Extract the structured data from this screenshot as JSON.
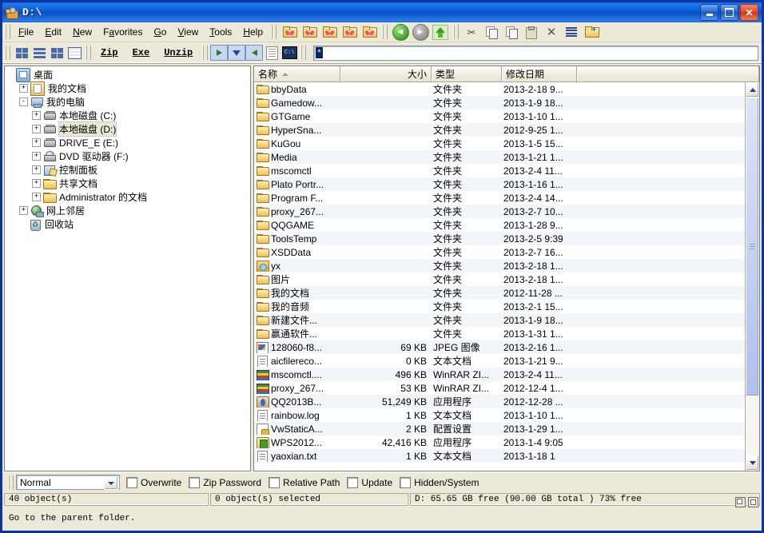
{
  "window": {
    "title": "D:\\",
    "icon": "folder-disk-icon",
    "buttons": {
      "minimize": "_",
      "maximize": "□",
      "close": "✕"
    }
  },
  "menubar": {
    "items": [
      {
        "label": "File",
        "accel": "F"
      },
      {
        "label": "Edit",
        "accel": "E"
      },
      {
        "label": "New",
        "accel": "N"
      },
      {
        "label": "Favorites",
        "accel": "a"
      },
      {
        "label": "Go",
        "accel": "G"
      },
      {
        "label": "View",
        "accel": "V"
      },
      {
        "label": "Tools",
        "accel": "T"
      },
      {
        "label": "Help",
        "accel": "H"
      }
    ],
    "favorite_icons": [
      "heart-folder-icon",
      "heart-folder-icon",
      "heart-folder-icon",
      "heart-folder-icon",
      "heart-folder-icon"
    ],
    "nav_icons": [
      "back-icon",
      "forward-icon",
      "up-folder-icon"
    ],
    "edit_icons": [
      "cut-icon",
      "copy-icon",
      "move-icon",
      "paste-icon",
      "delete-icon",
      "properties-icon",
      "new-folder-icon"
    ]
  },
  "toolbar2": {
    "view_icons": [
      "view-icons-icon",
      "view-small-icons-icon",
      "view-list-icon",
      "view-details-icon"
    ],
    "actions": [
      {
        "label": "Zip"
      },
      {
        "label": "Exe"
      },
      {
        "label": "Unzip"
      }
    ],
    "extra_icons": [
      "extract-to-icon",
      "install-icon",
      "add-to-icon",
      "notes-icon",
      "console-icon"
    ],
    "filter": {
      "value": "*",
      "placeholder": ""
    }
  },
  "tree": {
    "nodes": [
      {
        "label": "桌面",
        "icon": "desktop-icon",
        "indent": 0,
        "expander": "none",
        "selected": false
      },
      {
        "label": "我的文档",
        "icon": "my-documents-icon",
        "indent": 1,
        "expander": "+",
        "selected": false
      },
      {
        "label": "我的电脑",
        "icon": "my-computer-icon",
        "indent": 1,
        "expander": "-",
        "selected": false
      },
      {
        "label": "本地磁盘 (C:)",
        "icon": "hard-disk-icon",
        "indent": 2,
        "expander": "+",
        "selected": false
      },
      {
        "label": "本地磁盘 (D:)",
        "icon": "hard-disk-icon",
        "indent": 2,
        "expander": "+",
        "selected": true
      },
      {
        "label": "DRIVE_E (E:)",
        "icon": "hard-disk-icon",
        "indent": 2,
        "expander": "+",
        "selected": false
      },
      {
        "label": "DVD 驱动器 (F:)",
        "icon": "dvd-drive-icon",
        "indent": 2,
        "expander": "+",
        "selected": false
      },
      {
        "label": "控制面板",
        "icon": "control-panel-icon",
        "indent": 2,
        "expander": "+",
        "selected": false
      },
      {
        "label": "共享文档",
        "icon": "folder-icon",
        "indent": 2,
        "expander": "+",
        "selected": false
      },
      {
        "label": "Administrator 的文档",
        "icon": "folder-icon",
        "indent": 2,
        "expander": "+",
        "selected": false
      },
      {
        "label": "网上邻居",
        "icon": "network-icon",
        "indent": 1,
        "expander": "+",
        "selected": false
      },
      {
        "label": "回收站",
        "icon": "recycle-bin-icon",
        "indent": 1,
        "expander": "none",
        "selected": false
      }
    ]
  },
  "filelist": {
    "columns": [
      {
        "label": "名称",
        "sorted": true
      },
      {
        "label": "大小",
        "sorted": false
      },
      {
        "label": "类型",
        "sorted": false
      },
      {
        "label": "修改日期",
        "sorted": false
      }
    ],
    "rows": [
      {
        "name": "bbyData",
        "size": "",
        "type": "文件夹",
        "date": "2013-2-18 9...",
        "icon": "folder-icon"
      },
      {
        "name": "Gamedow...",
        "size": "",
        "type": "文件夹",
        "date": "2013-1-9 18...",
        "icon": "folder-icon"
      },
      {
        "name": "GTGame",
        "size": "",
        "type": "文件夹",
        "date": "2013-1-10 1...",
        "icon": "folder-icon"
      },
      {
        "name": "HyperSna...",
        "size": "",
        "type": "文件夹",
        "date": "2012-9-25 1...",
        "icon": "folder-icon"
      },
      {
        "name": "KuGou",
        "size": "",
        "type": "文件夹",
        "date": "2013-1-5 15...",
        "icon": "folder-icon"
      },
      {
        "name": "Media",
        "size": "",
        "type": "文件夹",
        "date": "2013-1-21 1...",
        "icon": "folder-icon"
      },
      {
        "name": "mscomctl",
        "size": "",
        "type": "文件夹",
        "date": "2013-2-4 11...",
        "icon": "folder-icon"
      },
      {
        "name": "Plato Portr...",
        "size": "",
        "type": "文件夹",
        "date": "2013-1-16 1...",
        "icon": "folder-icon"
      },
      {
        "name": "Program F...",
        "size": "",
        "type": "文件夹",
        "date": "2013-2-4 14...",
        "icon": "folder-icon"
      },
      {
        "name": "proxy_267...",
        "size": "",
        "type": "文件夹",
        "date": "2013-2-7 10...",
        "icon": "folder-icon"
      },
      {
        "name": "QQGAME",
        "size": "",
        "type": "文件夹",
        "date": "2013-1-28 9...",
        "icon": "folder-icon"
      },
      {
        "name": "ToolsTemp",
        "size": "",
        "type": "文件夹",
        "date": "2013-2-5 9:39",
        "icon": "folder-icon"
      },
      {
        "name": "XSDData",
        "size": "",
        "type": "文件夹",
        "date": "2013-2-7 16...",
        "icon": "folder-icon"
      },
      {
        "name": "yx",
        "size": "",
        "type": "文件夹",
        "date": "2013-2-18 1...",
        "icon": "special-folder-icon"
      },
      {
        "name": "图片",
        "size": "",
        "type": "文件夹",
        "date": "2013-2-18 1...",
        "icon": "folder-icon"
      },
      {
        "name": "我的文档",
        "size": "",
        "type": "文件夹",
        "date": "2012-11-28 ...",
        "icon": "folder-icon"
      },
      {
        "name": "我的音频",
        "size": "",
        "type": "文件夹",
        "date": "2013-2-1 15...",
        "icon": "folder-icon"
      },
      {
        "name": "新建文件...",
        "size": "",
        "type": "文件夹",
        "date": "2013-1-9 18...",
        "icon": "folder-icon"
      },
      {
        "name": "赢通软件...",
        "size": "",
        "type": "文件夹",
        "date": "2013-1-31 1...",
        "icon": "folder-icon"
      },
      {
        "name": "128060-f8...",
        "size": "69 KB",
        "type": "JPEG 图像",
        "date": "2013-2-16 1...",
        "icon": "jpeg-image-icon"
      },
      {
        "name": "aicfilereco...",
        "size": "0 KB",
        "type": "文本文档",
        "date": "2013-1-21 9...",
        "icon": "text-document-icon"
      },
      {
        "name": "mscomctl....",
        "size": "496 KB",
        "type": "WinRAR ZI...",
        "date": "2013-2-4 11...",
        "icon": "winrar-archive-icon"
      },
      {
        "name": "proxy_267...",
        "size": "53 KB",
        "type": "WinRAR ZI...",
        "date": "2012-12-4 1...",
        "icon": "winrar-archive-icon"
      },
      {
        "name": "QQ2013B...",
        "size": "51,249 KB",
        "type": "应用程序",
        "date": "2012-12-28 ...",
        "icon": "application-qq-icon"
      },
      {
        "name": "rainbow.log",
        "size": "1 KB",
        "type": "文本文档",
        "date": "2013-1-10 1...",
        "icon": "text-document-icon"
      },
      {
        "name": "VwStaticA...",
        "size": "2 KB",
        "type": "配置设置",
        "date": "2013-1-29 1...",
        "icon": "config-settings-icon"
      },
      {
        "name": "WPS2012...",
        "size": "42,416 KB",
        "type": "应用程序",
        "date": "2013-1-4 9:05",
        "icon": "application-wps-icon"
      },
      {
        "name": "yaoxian.txt",
        "size": "1 KB",
        "type": "文本文档",
        "date": "2013-1-18 1",
        "icon": "text-document-icon"
      }
    ]
  },
  "options": {
    "mode": {
      "value": "Normal"
    },
    "checkboxes": [
      {
        "label": "Overwrite",
        "checked": false
      },
      {
        "label": "Zip Password",
        "checked": false
      },
      {
        "label": "Relative Path",
        "checked": false
      },
      {
        "label": "Update",
        "checked": false
      },
      {
        "label": "Hidden/System",
        "checked": false
      }
    ]
  },
  "status": {
    "objects": "40 object(s)",
    "selected": "0 object(s) selected",
    "drive": "D: 65.65 GB free (90.00 GB total )  73% free"
  },
  "hint": {
    "text": "Go to the parent folder."
  }
}
